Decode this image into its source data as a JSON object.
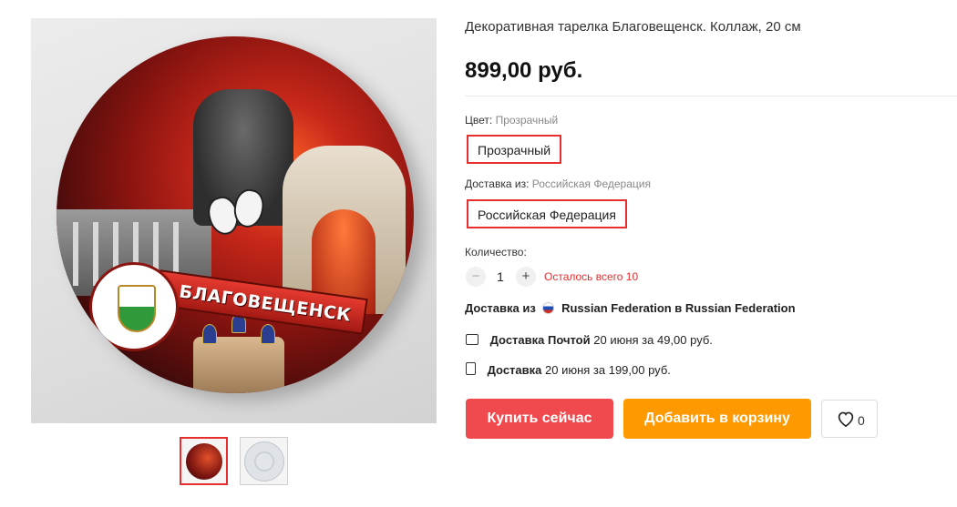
{
  "product": {
    "title": "Декоративная тарелка Благовещенск. Коллаж, 20 см",
    "price": "899,00 руб.",
    "image_caption": "БЛАГОВЕЩЕНСК"
  },
  "color": {
    "label": "Цвет:",
    "selected": "Прозрачный",
    "option": "Прозрачный"
  },
  "ship_origin": {
    "label": "Доставка из:",
    "selected": "Российская Федерация",
    "option": "Российская Федерация"
  },
  "quantity": {
    "label": "Количество:",
    "minus": "−",
    "value": "1",
    "plus": "+",
    "stock": "Осталось всего 10"
  },
  "shipping": {
    "from_prefix": "Доставка из",
    "from_suffix": "Russian Federation в Russian Federation",
    "post_method": "Доставка Почтой",
    "post_details": "20 июня за 49,00 руб.",
    "std_method": "Доставка",
    "std_details": "20 июня за 199,00 руб."
  },
  "actions": {
    "buy_now": "Купить сейчас",
    "add_to_cart": "Добавить в корзину",
    "wishlist_count": "0"
  },
  "colors": {
    "accent_red": "#e62e2e",
    "buy_button": "#f04a4f",
    "cart_button": "#ff9900"
  },
  "icons": {
    "heart": "heart-icon",
    "flag": "russia-flag-icon",
    "post": "post-parcel-icon",
    "delivery": "delivery-box-icon"
  }
}
